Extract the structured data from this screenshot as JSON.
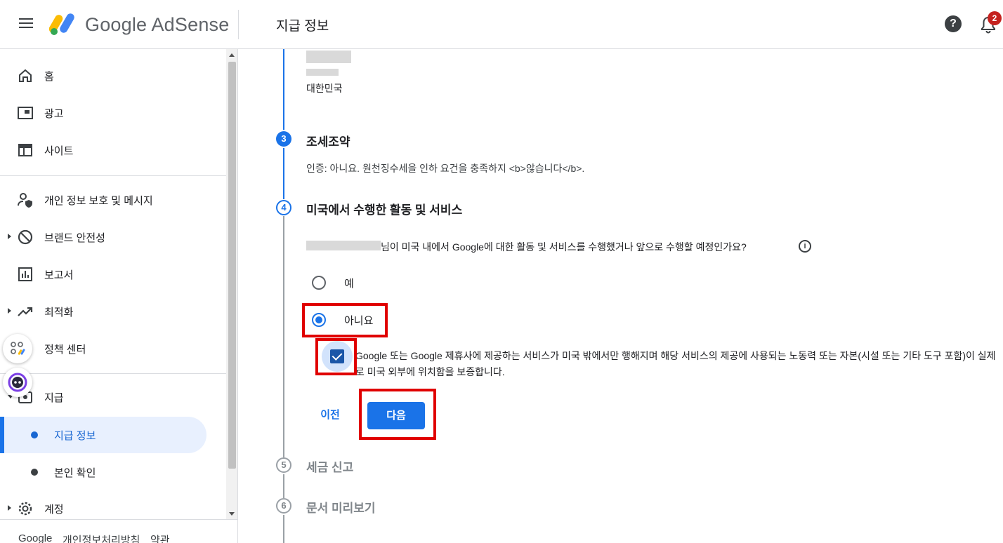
{
  "header": {
    "brand": "Google AdSense",
    "page_title": "지급 정보",
    "help": "?",
    "notification_count": "2"
  },
  "sidebar": {
    "items": [
      {
        "label": "홈"
      },
      {
        "label": "광고"
      },
      {
        "label": "사이트"
      },
      {
        "label": "개인 정보 보호 및 메시지"
      },
      {
        "label": "브랜드 안전성"
      },
      {
        "label": "보고서"
      },
      {
        "label": "최적화"
      },
      {
        "label": "정책 센터"
      },
      {
        "label": "지급"
      },
      {
        "label": "계정"
      }
    ],
    "sub_items": [
      {
        "label": "지급 정보"
      },
      {
        "label": "본인 확인"
      }
    ],
    "footer": {
      "google": "Google",
      "privacy": "개인정보처리방침",
      "terms": "약관"
    }
  },
  "main": {
    "address_country": "대한민국",
    "steps": [
      {
        "num": "3",
        "title": "조세조약",
        "desc": "인증: 아니요. 원천징수세을 인하 요건을 충족하지 <b>않습니다</b>."
      },
      {
        "num": "4",
        "title": "미국에서 수행한 활동 및 서비스"
      },
      {
        "num": "5",
        "title": "세금 신고"
      },
      {
        "num": "6",
        "title": "문서 미리보기"
      }
    ],
    "question": "님이 미국 내에서 Google에 대한 활동 및 서비스를 수행했거나 앞으로 수행할 예정인가요?",
    "info": "i",
    "options": [
      {
        "label": "예",
        "checked": false
      },
      {
        "label": "아니요",
        "checked": true
      }
    ],
    "checkbox_text": "Google 또는 Google 제휴사에 제공하는 서비스가 미국 밖에서만 행해지며 해당 서비스의 제공에 사용되는 노동력 또는 자본(시설 또는 기타 도구 포함)이 실제로 미국 외부에 위치함을 보증합니다.",
    "checkbox_checked": true,
    "btn_prev": "이전",
    "btn_next": "다음"
  },
  "colors": {
    "primary": "#1a73e8",
    "highlight": "#e00000"
  }
}
